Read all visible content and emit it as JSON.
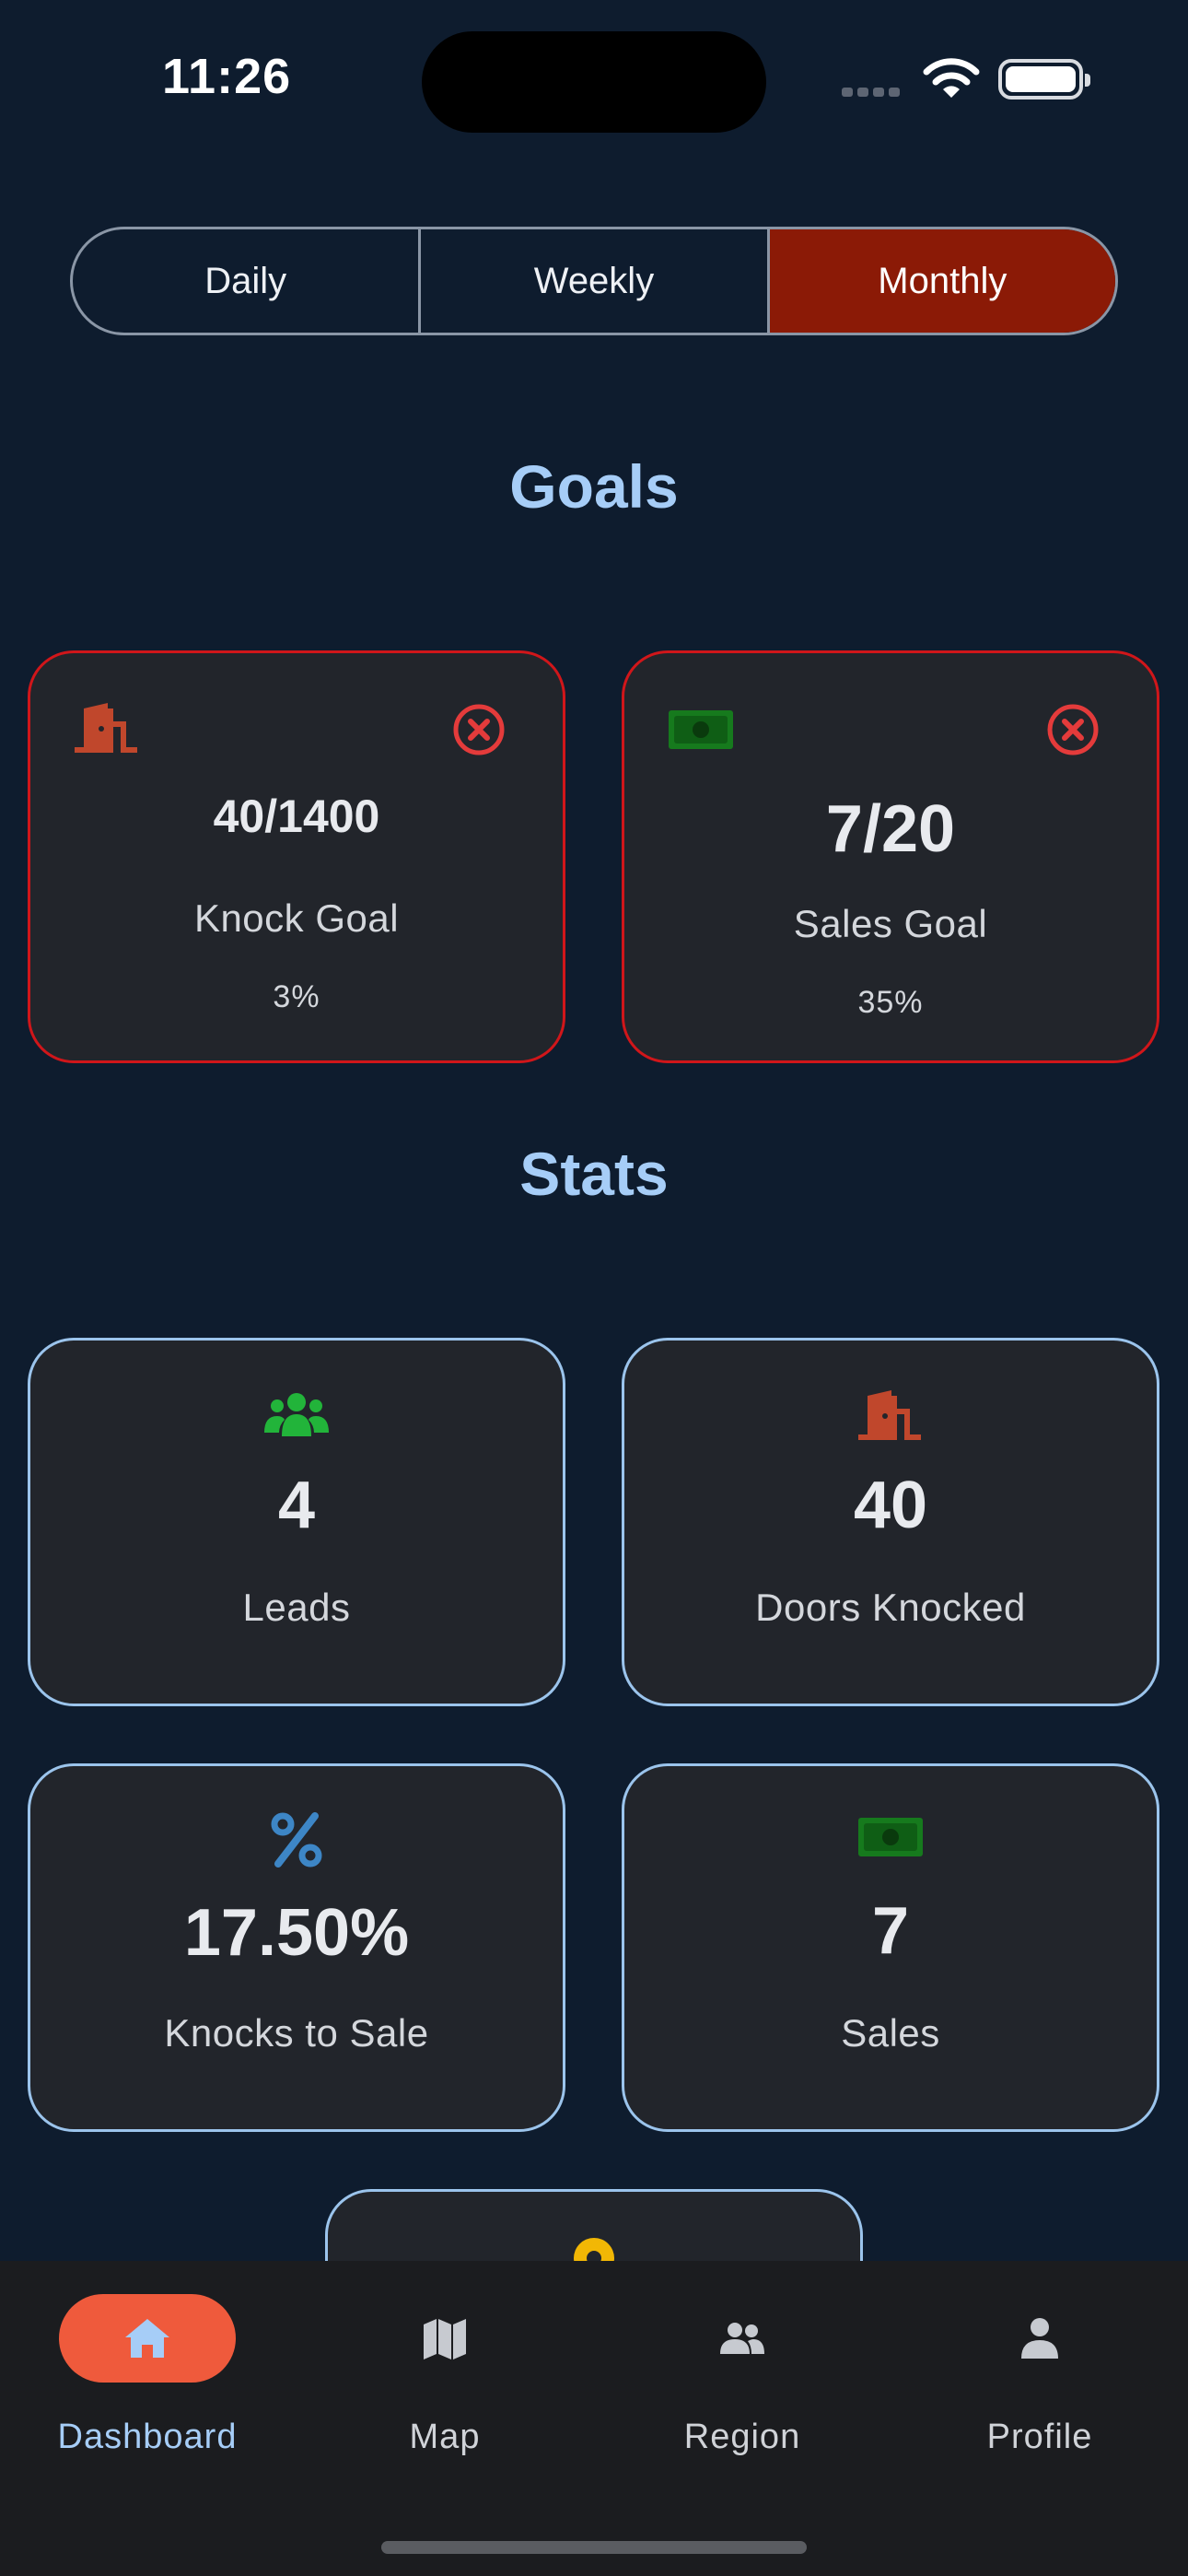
{
  "status_bar": {
    "time": "11:26"
  },
  "period_tabs": {
    "items": [
      {
        "label": "Daily",
        "active": false
      },
      {
        "label": "Weekly",
        "active": false
      },
      {
        "label": "Monthly",
        "active": true
      }
    ]
  },
  "goals": {
    "title": "Goals",
    "cards": [
      {
        "value": "40/1400",
        "label": "Knock Goal",
        "percent": "3%",
        "progress": 0.03,
        "icon": "door-icon",
        "status_icon": "close-circle-icon"
      },
      {
        "value": "7/20",
        "label": "Sales Goal",
        "percent": "35%",
        "progress": 0.35,
        "icon": "money-icon",
        "status_icon": "close-circle-icon"
      }
    ]
  },
  "stats": {
    "title": "Stats",
    "cards": [
      {
        "value": "4",
        "label": "Leads",
        "icon": "group-icon"
      },
      {
        "value": "40",
        "label": "Doors Knocked",
        "icon": "door-icon"
      },
      {
        "value": "17.50%",
        "label": "Knocks to Sale",
        "icon": "percent-icon"
      },
      {
        "value": "7",
        "label": "Sales",
        "icon": "money-icon"
      }
    ]
  },
  "nav": {
    "items": [
      {
        "label": "Dashboard",
        "icon": "home-icon",
        "active": true
      },
      {
        "label": "Map",
        "icon": "map-icon",
        "active": false
      },
      {
        "label": "Region",
        "icon": "people-icon",
        "active": false
      },
      {
        "label": "Profile",
        "icon": "person-icon",
        "active": false
      }
    ]
  },
  "colors": {
    "background": "#0e1c2e",
    "card": "#22252b",
    "accent_active_tab": "#8b1a06",
    "goal_border": "#d0161a",
    "stat_border": "#9bc4ec",
    "title": "#a6cdf7",
    "nav_active": "#ef5a3c"
  }
}
